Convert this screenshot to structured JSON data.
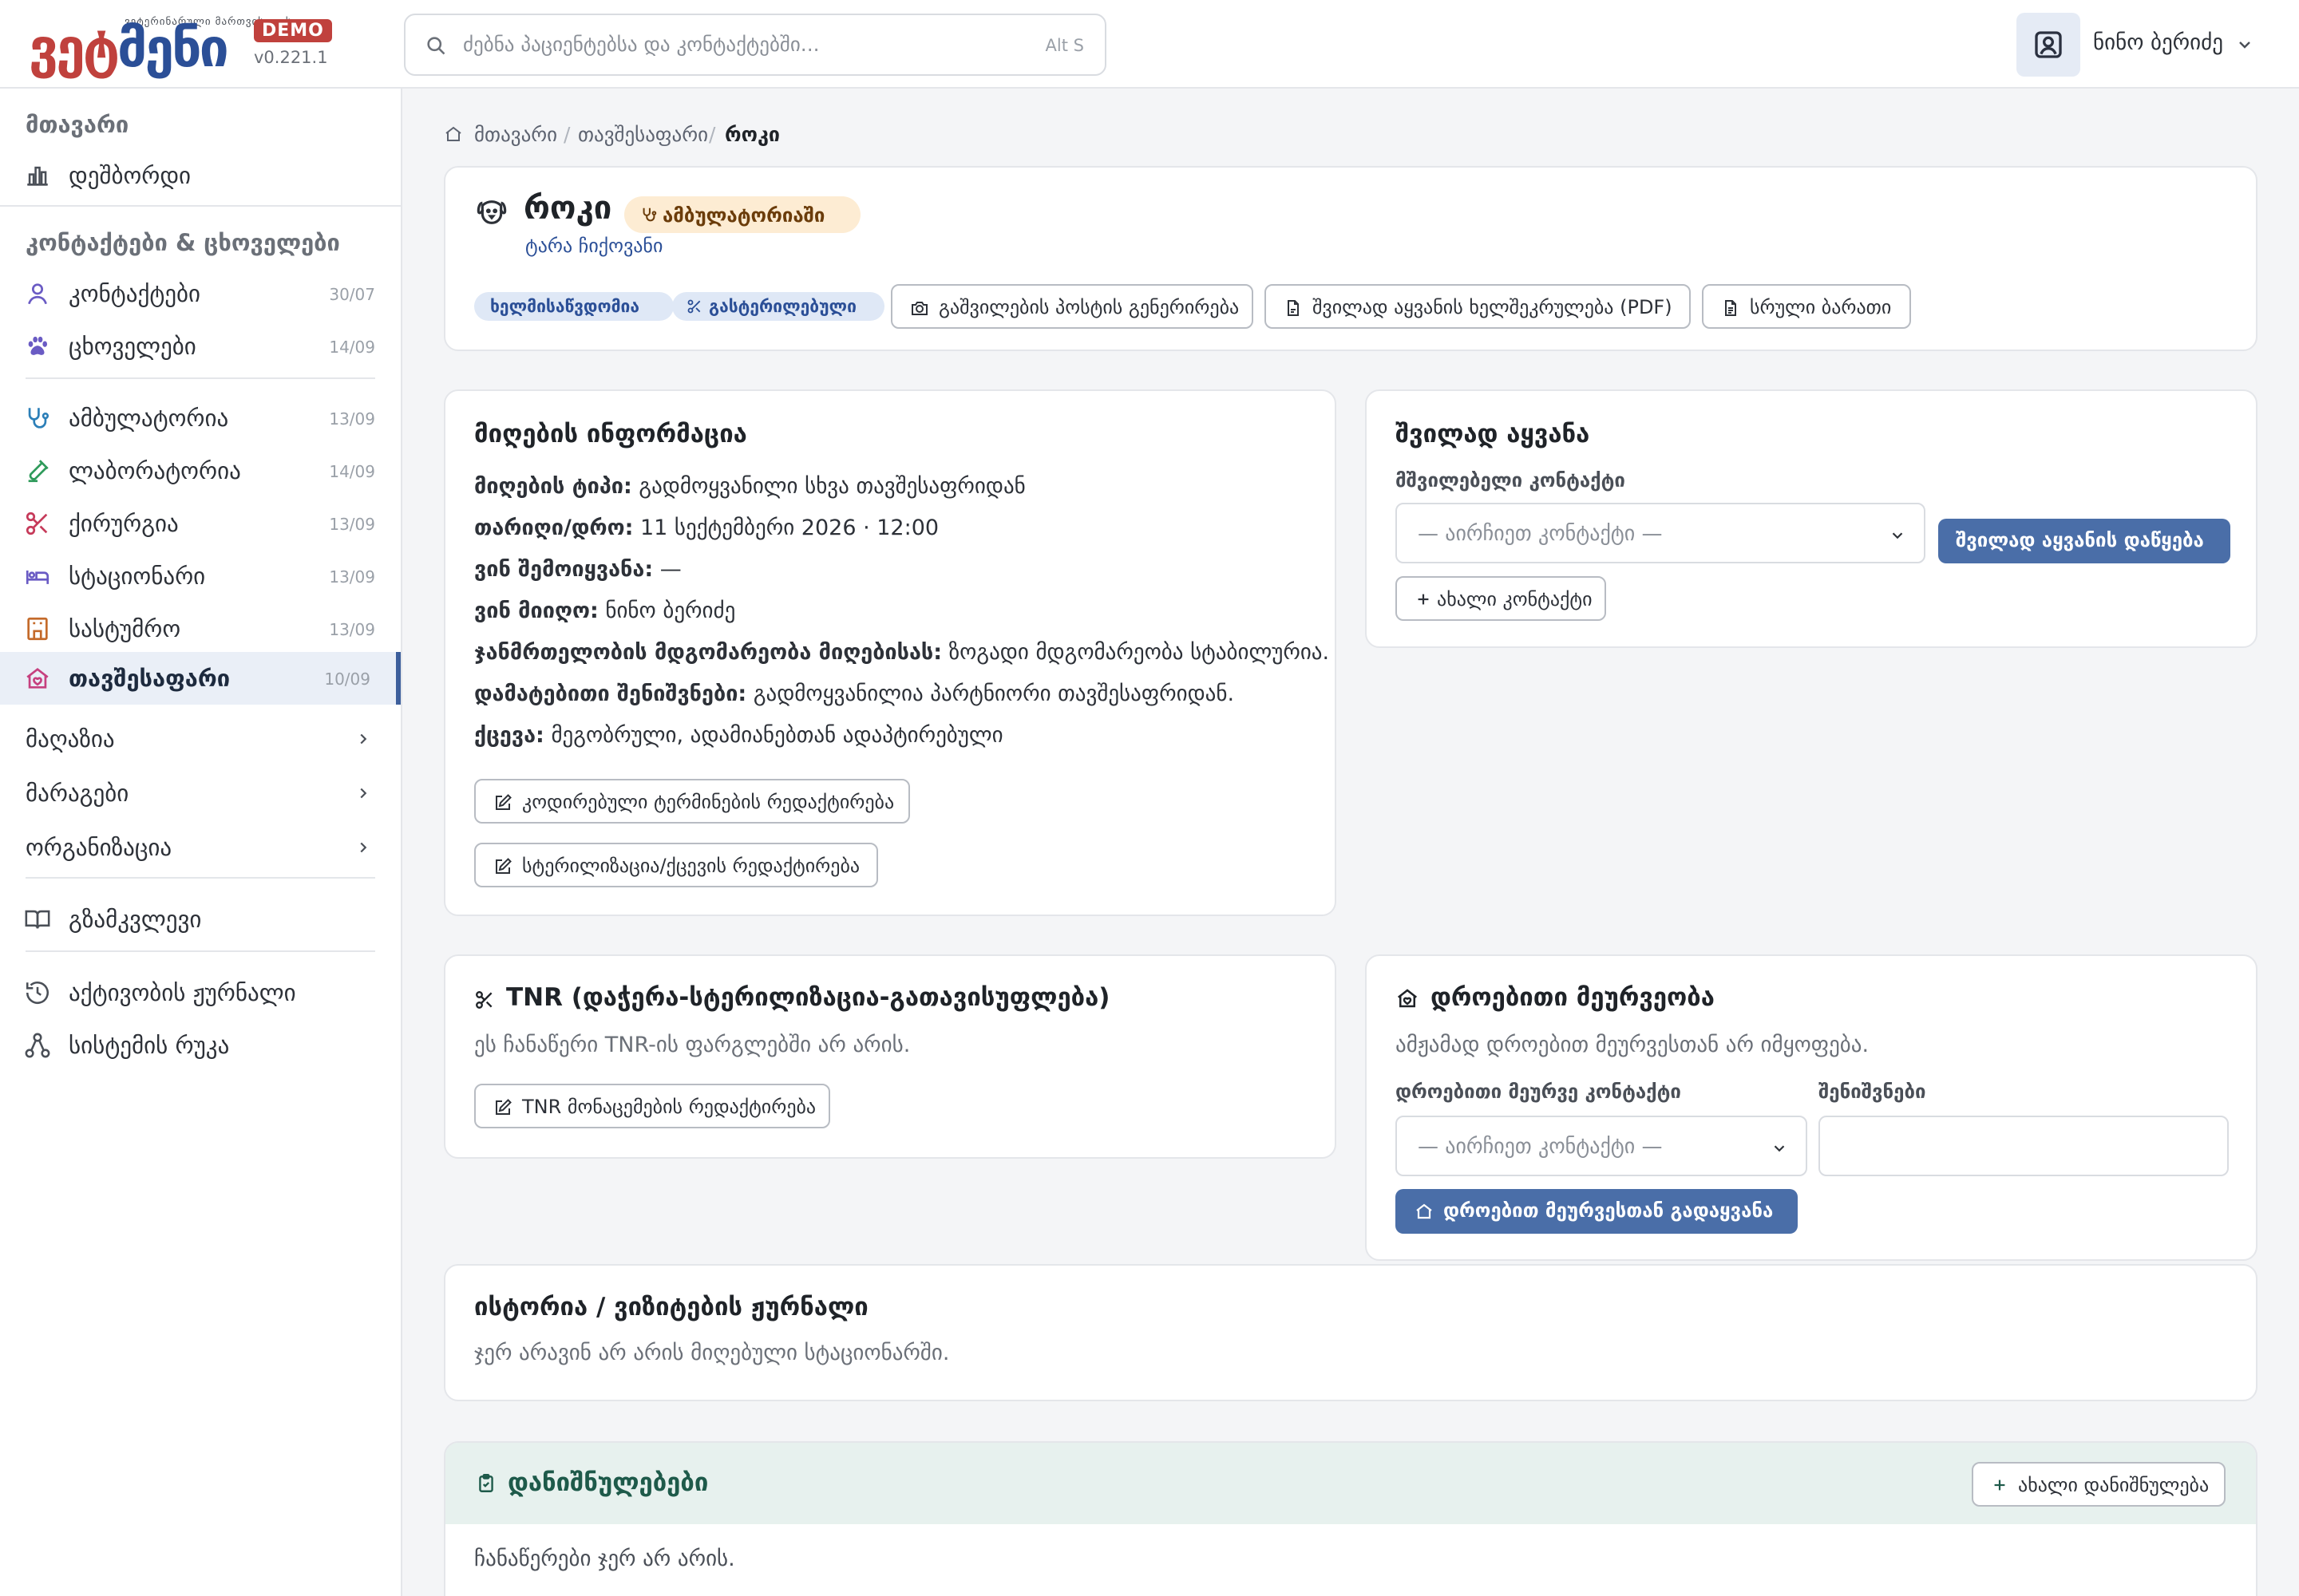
{
  "app": {
    "logo_small": "ვეტერინარული მართვისთვის",
    "logo_part1": "ვეტ",
    "logo_part2": "მენი",
    "badge": "DEMO",
    "version": "v0.221.1"
  },
  "search": {
    "placeholder": "ძებნა პაციენტებსა და კონტაქტებში...",
    "shortcut": "Alt S"
  },
  "user": {
    "name": "ნინო ბერიძე"
  },
  "sidebar": {
    "section_main": "მთავარი",
    "dashboard": "დეშბორდი",
    "section_contacts": "კონტაქტები & ცხოველები",
    "contacts": {
      "label": "კონტაქტები",
      "count": "30/07"
    },
    "animals": {
      "label": "ცხოველები",
      "count": "14/09"
    },
    "outpatient": {
      "label": "ამბულატორია",
      "count": "13/09"
    },
    "laboratory": {
      "label": "ლაბორატორია",
      "count": "14/09"
    },
    "surgery": {
      "label": "ქირურგია",
      "count": "13/09"
    },
    "inpatient": {
      "label": "სტაციონარი",
      "count": "13/09"
    },
    "hotel": {
      "label": "სასტუმრო",
      "count": "13/09"
    },
    "shelter": {
      "label": "თავშესაფარი",
      "count": "10/09"
    },
    "shop": "მაღაზია",
    "stock": "მარაგები",
    "organization": "ორგანიზაცია",
    "guide": "გზამკვლევი",
    "activity_log": "აქტივობის ჟურნალი",
    "system_map": "სისტემის რუკა"
  },
  "breadcrumb": {
    "home": "მთავარი",
    "shelter": "თავშესაფარი",
    "current": "როკი"
  },
  "patient": {
    "name": "როკი",
    "status": "ამბულატორიაში",
    "owner": "ტარა ჩიქოვანი",
    "tags": [
      "ხელმისაწვდომია",
      "გასტერილებული"
    ],
    "actions": [
      "გაშვილების პოსტის გენერირება",
      "შვილად აყვანის ხელშეკრულება (PDF)",
      "სრული ბარათი"
    ]
  },
  "intake": {
    "title": "მიღების ინფორმაცია",
    "rows": [
      {
        "label": "მიღების ტიპი:",
        "value": "გადმოყვანილი სხვა თავშესაფრიდან"
      },
      {
        "label": "თარიღი/დრო:",
        "value": "11 სექტემბერი 2026 · 12:00"
      },
      {
        "label": "ვინ შემოიყვანა:",
        "value": "—"
      },
      {
        "label": "ვინ მიიღო:",
        "value": "ნინო ბერიძე"
      },
      {
        "label": "ჯანმრთელობის მდგომარეობა მიღებისას:",
        "value": "ზოგადი მდგომარეობა სტაბილურია."
      },
      {
        "label": "დამატებითი შენიშვნები:",
        "value": "გადმოყვანილია პარტნიორი თავშესაფრიდან."
      },
      {
        "label": "ქცევა:",
        "value": "მეგობრული, ადამიანებთან ადაპტირებული"
      }
    ],
    "btn_coded": "კოდირებული ტერმინების რედაქტირება",
    "btn_sterilization": "სტერილიზაცია/ქცევის რედაქტირება"
  },
  "adoption": {
    "title": "შვილად აყვანა",
    "field_label": "მშვილებელი კონტაქტი",
    "select_value": "— აირჩიეთ კონტაქტი —",
    "btn_start": "შვილად აყვანის დაწყება",
    "btn_new_contact": "ახალი კონტაქტი"
  },
  "tnr": {
    "title": "TNR (დაჭერა-სტერილიზაცია-გათავისუფლება)",
    "desc": "ეს ჩანაწერი TNR-ის ფარგლებში არ არის.",
    "btn_edit": "TNR მონაცემების რედაქტირება"
  },
  "foster": {
    "title": "დროებითი მეურვეობა",
    "desc": "ამჟამად დროებით მეურვესთან არ იმყოფება.",
    "contact_label": "დროებითი მეურვე კონტაქტი",
    "notes_label": "შენიშვნები",
    "select_value": "— აირჩიეთ კონტაქტი —",
    "btn_transfer": "დროებით მეურვესთან გადაყვანა"
  },
  "history": {
    "title": "ისტორია / ვიზიტების ჟურნალი",
    "desc": "ჯერ არავინ არ არის მიღებული სტაციონარში."
  },
  "appointments": {
    "title": "დანიშნულებები",
    "btn_new": "ახალი დანიშნულება",
    "empty": "ჩანაწერები ჯერ არ არის."
  },
  "colors": {
    "brand_red": "#c0413d",
    "brand_blue": "#2b4f97",
    "primary": "#4a6ea8",
    "active_bg": "#eaeff7"
  }
}
